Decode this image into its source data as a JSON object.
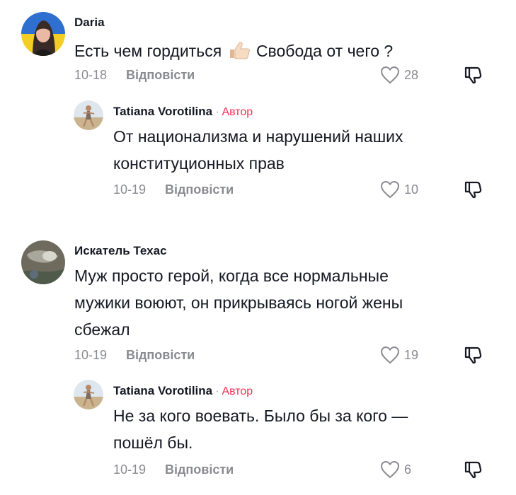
{
  "comments": [
    {
      "username": "Daria",
      "text_before": "Есть чем гордиться",
      "text_after": "Свобода от чего ?",
      "date": "10-18",
      "reply_label": "Відповісти",
      "likes": "28",
      "reply": {
        "username": "Tatiana Vorotilina",
        "author_tag": "Автор",
        "text_line1": "От национализма и нарушений наших",
        "text_line2": "конституционных прав",
        "date": "10-19",
        "reply_label": "Відповісти",
        "likes": "10"
      }
    },
    {
      "username": "Искатель Техас",
      "text_line1": "Муж просто герой, когда все нормальные",
      "text_line2": "мужики воюют, он прикрываясь ногой жены",
      "text_line3": "сбежал",
      "date": "10-19",
      "reply_label": "Відповісти",
      "likes": "19",
      "reply": {
        "username": "Tatiana Vorotilina",
        "author_tag": "Автор",
        "text_line1": "Не за кого воевать. Было бы за кого —",
        "text_line2": "пошёл бы.",
        "date": "10-19",
        "reply_label": "Відповісти",
        "likes": "6"
      }
    }
  ],
  "colors": {
    "author_tag": "#fe2c55",
    "meta": "#8a8b91",
    "text": "#161823"
  }
}
